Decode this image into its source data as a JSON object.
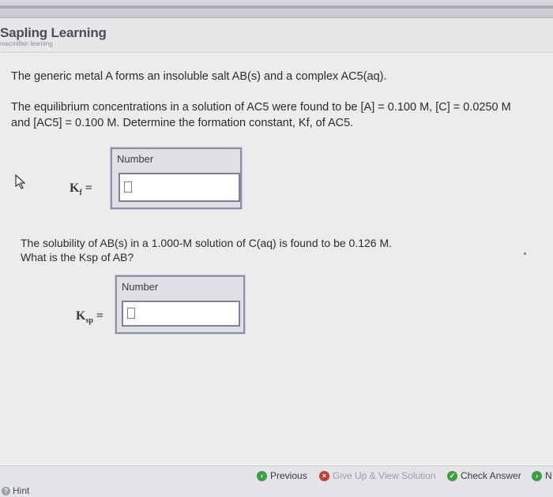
{
  "brand": {
    "name": "Sapling Learning",
    "tagline": "macmillan learning"
  },
  "question": {
    "intro": "The generic metal A forms an insoluble salt AB(s) and a complex AC5(aq).",
    "line1": "The equilibrium concentrations in a solution of AC5 were found to be [A] = 0.100 M, [C] = 0.0250 M",
    "line2": "and [AC5] = 0.100 M. Determine the formation constant, Kf, of AC5.",
    "part2_line1": "The solubility of AB(s) in a 1.000-M solution of C(aq) is found to be 0.126 M.",
    "part2_line2": "What is the Ksp of AB?"
  },
  "answer_kf": {
    "box_label": "Number",
    "symbol": "K",
    "subscript": "f",
    "equals": "=",
    "value": ""
  },
  "answer_ksp": {
    "box_label": "Number",
    "symbol": "K",
    "subscript": "sp",
    "equals": "=",
    "value": ""
  },
  "footer": {
    "previous": "Previous",
    "give_up": "Give Up & View Solution",
    "check": "Check Answer",
    "next": "N",
    "hint": "Hint"
  },
  "colors": {
    "previous_icon": "#3f9b44",
    "give_up_icon": "#b8433f",
    "check_icon": "#3f9b44"
  },
  "icons": [
    "cursor-icon",
    "previous-icon",
    "give-up-icon",
    "check-icon",
    "next-icon",
    "hint-icon"
  ]
}
